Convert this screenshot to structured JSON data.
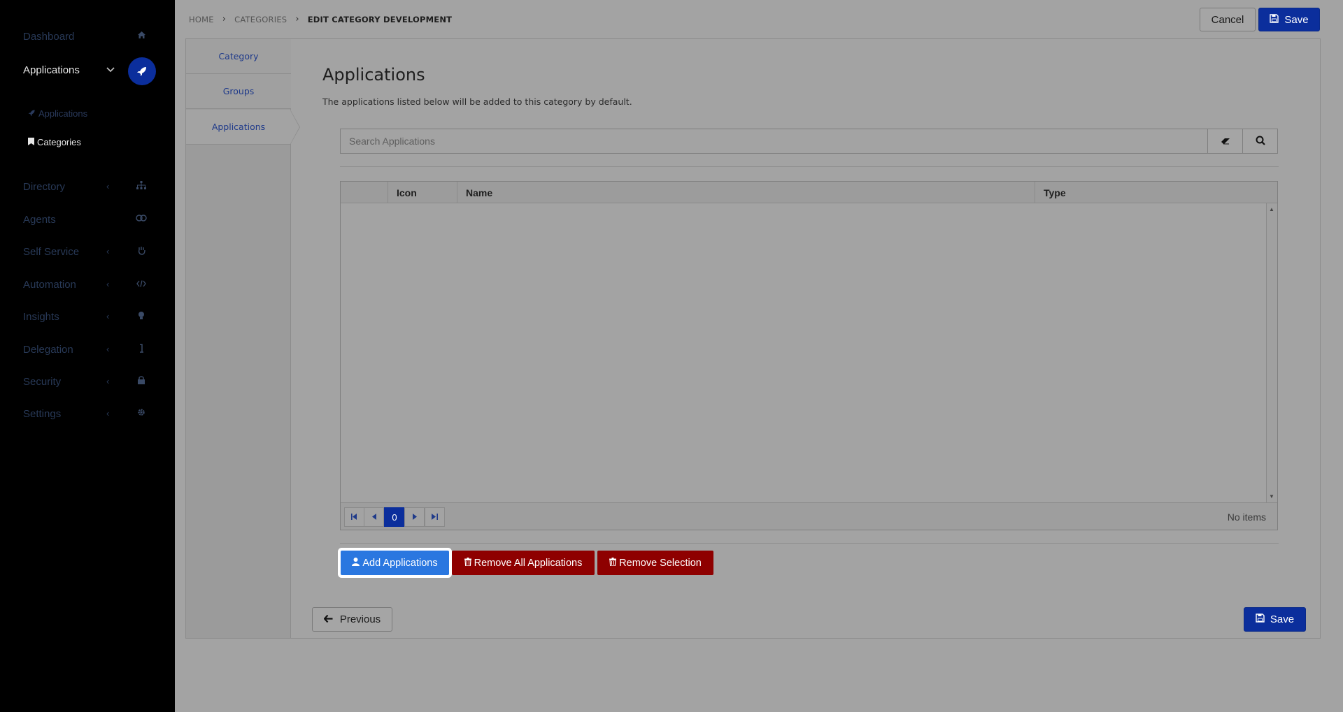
{
  "sidebar": {
    "items": [
      {
        "label": "Dashboard",
        "icon": "home-icon"
      },
      {
        "label": "Applications",
        "icon": "rocket-icon",
        "active": true
      },
      {
        "label": "Directory",
        "icon": "sitemap-icon"
      },
      {
        "label": "Agents",
        "icon": "agents-icon"
      },
      {
        "label": "Self Service",
        "icon": "hand-icon"
      },
      {
        "label": "Automation",
        "icon": "code-icon"
      },
      {
        "label": "Insights",
        "icon": "lightbulb-icon"
      },
      {
        "label": "Delegation",
        "icon": "delegation-icon"
      },
      {
        "label": "Security",
        "icon": "lock-icon"
      },
      {
        "label": "Settings",
        "icon": "gear-icon"
      }
    ],
    "subitems": [
      {
        "label": "Applications",
        "icon": "rocket-icon"
      },
      {
        "label": "Categories",
        "icon": "bookmark-icon"
      }
    ]
  },
  "breadcrumb": {
    "home": "HOME",
    "categories": "CATEGORIES",
    "current": "EDIT CATEGORY DEVELOPMENT"
  },
  "header": {
    "cancel_label": "Cancel",
    "save_label": "Save"
  },
  "tabs": [
    {
      "label": "Category"
    },
    {
      "label": "Groups"
    },
    {
      "label": "Applications",
      "active": true
    }
  ],
  "main": {
    "title": "Applications",
    "description": "The applications listed below will be added to this category by default.",
    "search_placeholder": "Search Applications"
  },
  "table": {
    "columns": [
      "",
      "Icon",
      "Name",
      "Type"
    ],
    "rows": [],
    "page": "0",
    "status": "No items"
  },
  "actions": {
    "add": "Add Applications",
    "remove_all": "Remove All Applications",
    "remove_selection": "Remove Selection"
  },
  "footer": {
    "previous_label": "Previous",
    "save_label": "Save"
  },
  "colors": {
    "primary": "#0b2e9c",
    "add_button": "#2a77e0",
    "danger": "#8e0000",
    "sidebar_bg": "#000000"
  }
}
